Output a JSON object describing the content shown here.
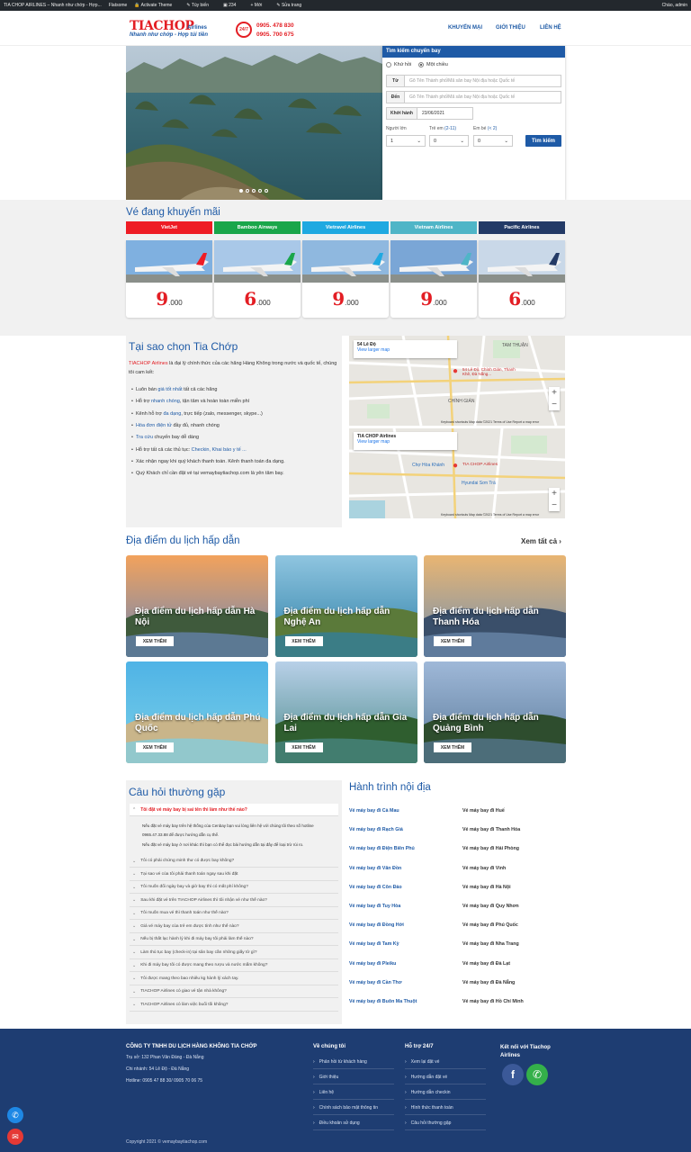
{
  "adminbar": {
    "items": [
      "TIA CHOP AIRLINES – Nhanh như chớp - Hợp...",
      "Flatsome",
      "Activate Theme",
      "Tùy biến",
      "234",
      "Mới",
      "Sửa trang"
    ],
    "greeting": "Chào, admin"
  },
  "header": {
    "logo": "TIACHOP",
    "logo_sub": "Airlines",
    "slogan": "Nhanh như chớp - Hợp túi tiền",
    "badge": "24/7",
    "phones": [
      "0905. 478 830",
      "0905. 700 675"
    ],
    "nav": [
      "KHUYẾN MẠI",
      "GIỚI THIỆU",
      "LIÊN HỆ"
    ]
  },
  "search": {
    "title": "Tìm kiếm chuyến bay",
    "trip_types": [
      "Khứ hồi",
      "Một chiều"
    ],
    "from_label": "Từ",
    "from_placeholder": "Gõ Tên Thành phố/Mã sân bay Nội địa hoặc Quốc tế",
    "to_label": "Đến",
    "to_placeholder": "Gõ Tên Thành phố/Mã sân bay Nội địa hoặc Quốc tế",
    "date_label": "Khởi hành",
    "date_value": "23/06/2021",
    "adults_label": "Người lớn",
    "children_label": "Trẻ em",
    "children_hint": "(2-11)",
    "infants_label": "Em bé",
    "infants_hint": "(< 2)",
    "adults_value": "1",
    "children_value": "0",
    "infants_value": "0",
    "submit": "Tìm kiếm"
  },
  "promo": {
    "title": "Vé đang khuyến mãi",
    "airlines": [
      {
        "name": "VietJet",
        "color": "#ee1c24",
        "price_big": "9",
        "price_small": ".000"
      },
      {
        "name": "Bamboo Airways",
        "color": "#1aa64a",
        "price_big": "6",
        "price_small": ".000"
      },
      {
        "name": "Vietravel Airlines",
        "color": "#1fa9e1",
        "price_big": "9",
        "price_small": ".000"
      },
      {
        "name": "Vietnam Airlines",
        "color": "#4fb5c7",
        "price_big": "9",
        "price_small": ".000"
      },
      {
        "name": "Pacific Airlines",
        "color": "#233a66",
        "price_big": "6",
        "price_small": ".000"
      }
    ]
  },
  "why": {
    "title": "Tại sao chọn Tia Chớp",
    "intro_brand": "TIACHOP Airlines",
    "intro_rest": " là đại lý chính thức của các hãng Hàng Không trong nước và quốc tế, chúng tôi cam kết:",
    "bullets": [
      {
        "a": "Luôn bán ",
        "b": "giá tốt nhất",
        "c": " tất cả các hãng"
      },
      {
        "a": "Hỗ trợ ",
        "b": "nhanh chóng",
        "c": ", tận tâm và hoàn toàn miễn phí"
      },
      {
        "a": "Kênh hỗ trợ ",
        "b": "đa dạng",
        "c": ", trực tiếp (zalo, messenger, skype...)"
      },
      {
        "a": "",
        "b": "Hóa đơn điện tử",
        "c": " đầy đủ, nhanh chóng"
      },
      {
        "a": "",
        "b": "Tra cứu",
        "c": " chuyến bay dễ dàng"
      },
      {
        "a": "Hỗ trợ tất cả các thủ tục: ",
        "b": "Checkin, Khai báo y tế ...",
        "c": ""
      },
      {
        "a": "Xác nhận ngay khi quý khách thanh toán. Kênh thanh toán đa dạng.",
        "b": "",
        "c": ""
      },
      {
        "a": "Quý Khách chỉ cần đặt vé tại vemaybaytiachop.com là yên tâm bay.",
        "b": "",
        "c": ""
      }
    ]
  },
  "maps": [
    {
      "title": "54 Lê Độ",
      "link": "View larger map",
      "pin_label": "54 Lê Độ, Chính Gián, Thanh Khê, Đà Nẵng...",
      "footer": "Keyboard shortcuts  Map data ©2021  Terms of Use  Report a map error"
    },
    {
      "title": "TIA CHOP Airlines",
      "link": "View larger map",
      "pin_label": "TIA CHOP Airlines",
      "footer": "Keyboard shortcuts  Map data ©2021  Terms of Use  Report a map error"
    }
  ],
  "destinations": {
    "title": "Địa điểm du lịch hấp dẫn",
    "see_all": "Xem tất cả",
    "button": "XEM THÊM",
    "items": [
      {
        "l1": "Địa điểm du lịch hấp dẫn Hà",
        "l2": "Nội"
      },
      {
        "l1": "Địa điểm du lịch hấp dẫn",
        "l2": "Nghệ An"
      },
      {
        "l1": "Địa điểm du lịch hấp dẫn",
        "l2": "Thanh Hóa"
      },
      {
        "l1": "Địa điểm du lịch hấp dẫn Phú",
        "l2": "Quốc"
      },
      {
        "l1": "Địa điểm du lịch hấp dẫn Gia",
        "l2": "Lai"
      },
      {
        "l1": "Địa điểm du lịch hấp dẫn",
        "l2": "Quảng Bình"
      }
    ]
  },
  "faq": {
    "title": "Câu hỏi thường gặp",
    "open_q": "Tôi đặt vé máy bay bị sai tên thì làm như thế nào?",
    "answer": [
      "Nếu đặt vé máy bay trên hệ thống của Cenbay bạn vui lòng liên hệ với chúng tôi theo số hotline",
      "0965.47.33.88 để được hướng dẫn cụ thể.",
      "Nếu đặt vé máy bay ở nơi khác thì bạn có thể đọc bài hướng dẫn tại đây để loại trừ rủi ro."
    ],
    "questions": [
      "Tôi có phải chứng minh thư có được bay không?",
      "Tại sao vé của tôi phải thanh toán ngay sau khi đặt",
      "Tôi muốn đổi ngày bay và giờ bay thì có mất phí không?",
      "Sau khi đặt vé trên TIACHOP Airlines thì tôi nhận vé như thế nào?",
      "Tôi muốn mua vé thì thanh toán như thế nào?",
      "Giá vé máy bay của trẻ em được tính như thế nào?",
      "Nếu bị thất lạc hành lý khi đi máy bay tôi phải làm thế nào?",
      "Làm thủ tục bay (check-in) tại sân bay cần những giấy tờ gì?",
      "Khi đi máy bay tôi có được mang theo rượu và nước mắm không?",
      "Tôi được mang theo bao nhiêu kg hành lý xách tay.",
      "TIACHOP Airlines có giao vé tận nhà không?",
      "TIACHOP Airlines có làm việc buổi tối không?"
    ]
  },
  "routes": {
    "title": "Hành trình nội địa",
    "left": [
      "Vé máy bay đi Cà Mau",
      "Vé máy bay đi Rạch Giá",
      "Vé máy bay đi Điện Biên Phủ",
      "Vé máy bay đi Vân Đồn",
      "Vé máy bay đi Côn Đảo",
      "Vé máy bay đi Tuy Hòa",
      "Vé máy bay đi Đồng Hới",
      "Vé máy bay đi Tam Kỳ",
      "Vé máy bay đi Pleiku",
      "Vé máy bay đi Cần Thơ",
      "Vé máy bay đi Buôn Ma Thuột"
    ],
    "right": [
      "Vé máy bay đi Huế",
      "Vé máy bay đi Thanh Hóa",
      "Vé máy bay đi Hải Phòng",
      "Vé máy bay đi Vinh",
      "Vé máy bay đi Hà Nội",
      "Vé máy bay đi Quy Nhơn",
      "Vé máy bay đi Phú Quốc",
      "Vé máy bay đi Nha Trang",
      "Vé máy bay đi Đà Lạt",
      "Vé máy bay đi Đà Nẵng",
      "Vé máy bay đi Hồ Chí Minh"
    ]
  },
  "footer": {
    "company": "CÔNG TY TNHH DU LỊCH HÀNG KHÔNG TIA CHỚP",
    "address": "Trụ sở: 132 Phan Văn Đáng - Đà Nẵng",
    "branch": "Chi nhánh: 54 Lê Độ - Đà Nẵng",
    "hotline": "Hotline: 0905 47 88 30/ 0905 70 06 75",
    "col1_title": "Về chúng tôi",
    "col1": [
      "Phản hồi từ khách hàng",
      "Giới thiệu",
      "Liên hệ",
      "Chính sách bảo mật thông tin",
      "Điều khoản sử dụng"
    ],
    "col2_title": "Hỗ trợ 24/7",
    "col2": [
      "Xem lại đặt vé",
      "Hướng dẫn đặt vé",
      "Hướng dẫn checkin",
      "Hình thức thanh toán",
      "Câu hỏi thường gặp"
    ],
    "social_title": "Kết nối với Tiachop Airlines",
    "copyright": "Copyright 2021 © vemaybaytiachop.com"
  }
}
